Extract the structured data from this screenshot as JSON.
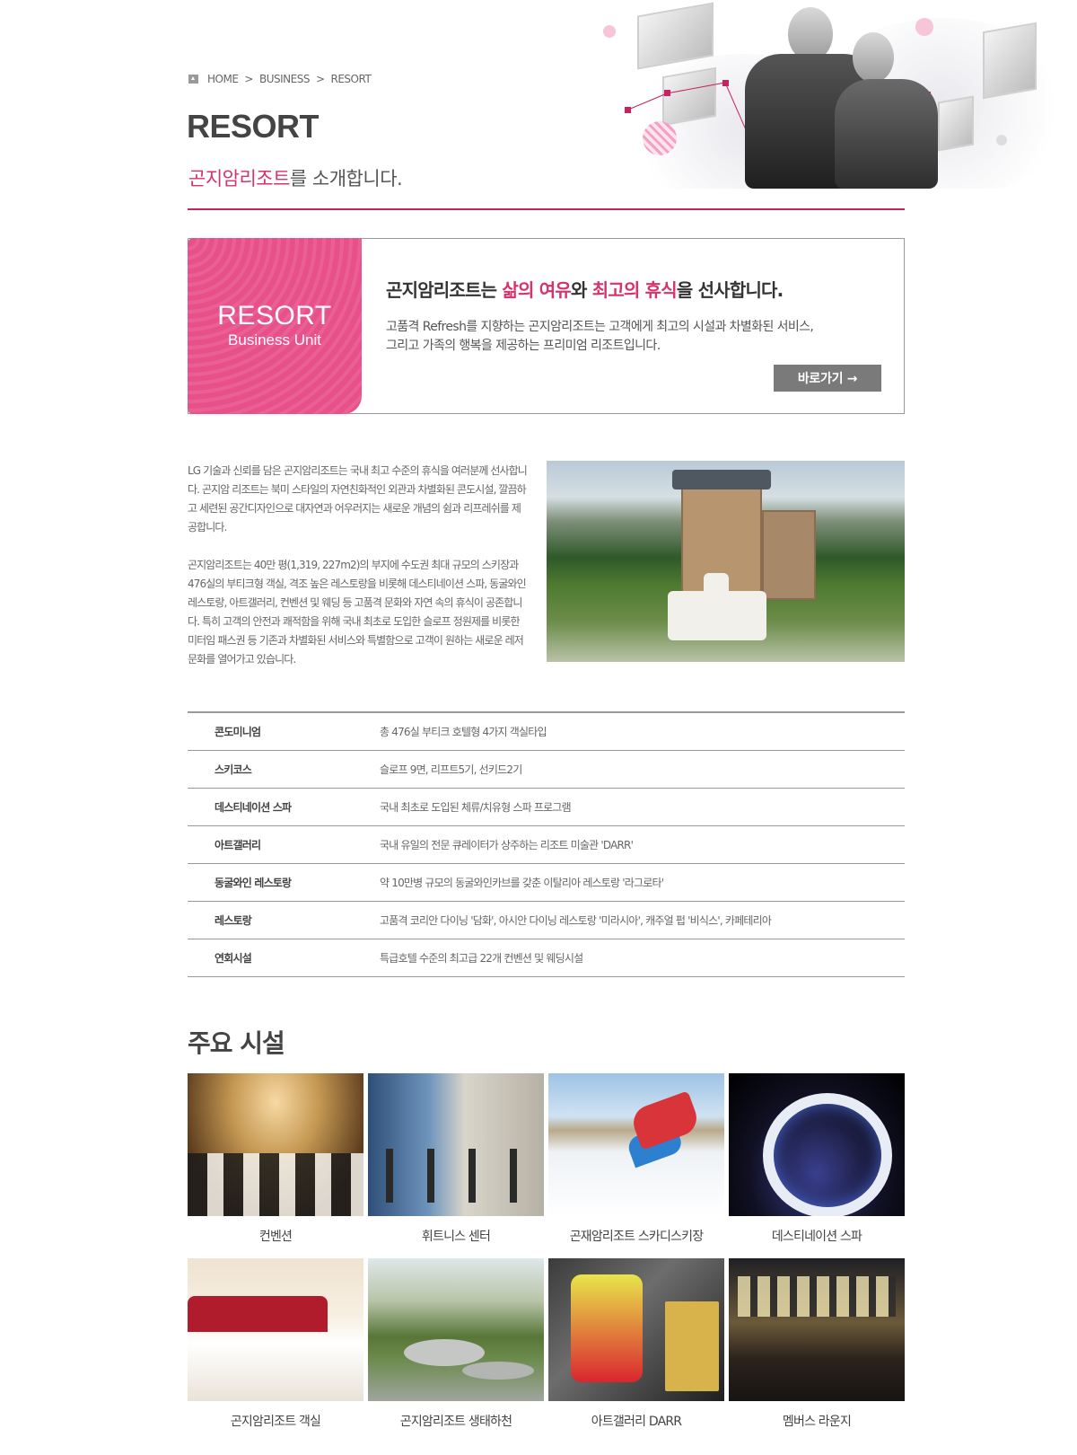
{
  "breadcrumb": {
    "home": "HOME",
    "sep": ">",
    "level1": "BUSINESS",
    "level2": "RESORT"
  },
  "page": {
    "title": "RESORT",
    "subtitle_highlight": "곤지암리조트",
    "subtitle_rest": "를 소개합니다."
  },
  "intro": {
    "badge_line1": "RESORT",
    "badge_line2": "Business Unit",
    "headline_part1": "곤지암리조트는 ",
    "headline_hl1": "삶의 여유",
    "headline_part2": "와 ",
    "headline_hl2": "최고의 휴식",
    "headline_part3": "을 선사합니다.",
    "text_line1": "고품격 Refresh를 지향하는 곤지암리조트는 고객에게 최고의 시설과 차별화된 서비스,",
    "text_line2": "그리고 가족의 행복을 제공하는 프리미엄 리조트입니다.",
    "button": "바로가기 →"
  },
  "description": {
    "para1": "LG 기술과 신뢰를 담은 곤지암리조트는 국내 최고 수준의 휴식을 여러분께 선사합니다. 곤지암 리조트는 북미 스타일의 자연친화적인 외관과 차별화된 콘도시설, 깔끔하고 세련된 공간디자인으로 대자연과 어우러지는 새로운 개념의 쉼과 리프레쉬를 제공합니다.",
    "para2": "곤지암리조트는 40만 평(1,319, 227m2)의 부지에 수도권 최대 규모의 스키장과 476실의 부티크형 객실, 격조 높은 레스토랑을 비롯해 데스티네이션 스파, 동굴와인 레스토랑, 아트갤러리, 컨벤션 및 웨딩 등 고품격 문화와 자연 속의 휴식이 공존합니다. 특히 고객의 안전과 쾌적함을 위해 국내 최초로 도입한 슬로프 정원제를 비롯한 미터임 패스권 등 기존과 차별화된 서비스와 특별함으로 고객이 원하는 새로운 레저 문화를 열어가고 있습니다."
  },
  "info_rows": [
    {
      "key": "콘도미니엄",
      "value": "총 476실 부티크 호텔형 4가지 객실타입"
    },
    {
      "key": "스키코스",
      "value": "슬로프 9면, 리프트5기, 선키드2기"
    },
    {
      "key": "데스티네이션 스파",
      "value": "국내 최초로 도입된 체류/치유형 스파 프로그램"
    },
    {
      "key": "아트갤러리",
      "value": "국내 유일의 전문 큐레이터가 상주하는 리조트 미술관 'DARR'"
    },
    {
      "key": "동굴와인 레스토랑",
      "value": "약 10만병 규모의 동굴와인카브를 갖춘 이탈리아 레스토랑 '라그로타'"
    },
    {
      "key": "레스토랑",
      "value": "고품격 코리안 다이닝 '담화', 아시안 다이닝 레스토랑 '미라시아', 캐주얼 펍 '비식스', 카페테리아"
    },
    {
      "key": "연회시설",
      "value": "특급호텔 수준의 최고급 22개 컨벤션 및 웨딩시설"
    }
  ],
  "facilities": {
    "title": "주요 시설",
    "items": [
      {
        "caption": "컨벤션",
        "image": "convention-photo"
      },
      {
        "caption": "휘트니스 센터",
        "image": "fitness-photo"
      },
      {
        "caption": "곤재암리조트 스카디스키장",
        "image": "ski-photo"
      },
      {
        "caption": "데스티네이션 스파",
        "image": "spa-photo"
      },
      {
        "caption": "곤지암리조트 객실",
        "image": "room-photo"
      },
      {
        "caption": "곤지암리조트 생태하천",
        "image": "stream-photo"
      },
      {
        "caption": "아트갤러리 DARR",
        "image": "gallery-photo"
      },
      {
        "caption": "멤버스 라운지",
        "image": "lounge-photo"
      }
    ]
  },
  "colors": {
    "accent": "#c8235f",
    "highlight": "#d6336c",
    "badge": "#e8508a",
    "button": "#7a7a7a"
  }
}
